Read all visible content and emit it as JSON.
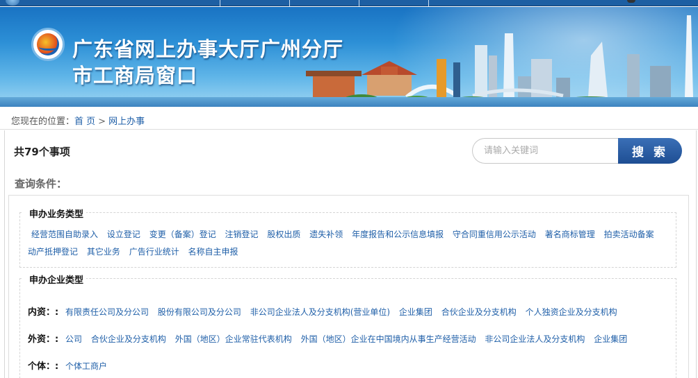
{
  "banner": {
    "title_line1": "广东省网上办事大厅广州分厅",
    "title_line2": "市工商局窗口"
  },
  "breadcrumb": {
    "prefix": "您现在的位置：",
    "home": "首 页",
    "separator": ">",
    "current": "网上办事"
  },
  "summary": {
    "count_label": "共79个事项"
  },
  "search": {
    "placeholder": "请输入关键词",
    "button_label": "搜 索"
  },
  "conditions": {
    "title": "查询条件：",
    "business_type": {
      "legend": "申办业务类型",
      "items": [
        "经营范围自助录入",
        "设立登记",
        "变更（备案）登记",
        "注销登记",
        "股权出质",
        "遗失补领",
        "年度报告和公示信息填报",
        "守合同重信用公示活动",
        "著名商标管理",
        "拍卖活动备案",
        "动产抵押登记",
        "其它业务",
        "广告行业统计",
        "名称自主申报"
      ]
    },
    "enterprise_type": {
      "legend": "申办企业类型",
      "domestic": {
        "label": "内资：:",
        "items": [
          "有限责任公司及分公司",
          "股份有限公司及分公司",
          "非公司企业法人及分支机构(营业单位)",
          "企业集团",
          "合伙企业及分支机构",
          "个人独资企业及分支机构"
        ]
      },
      "foreign": {
        "label": "外资：:",
        "items": [
          "公司",
          "合伙企业及分支机构",
          "外国（地区）企业常驻代表机构",
          "外国（地区）企业在中国境内从事生产经营活动",
          "非公司企业法人及分支机构",
          "企业集团"
        ]
      },
      "individual": {
        "label": "个体：:",
        "items": [
          "个体工商户"
        ]
      }
    }
  }
}
